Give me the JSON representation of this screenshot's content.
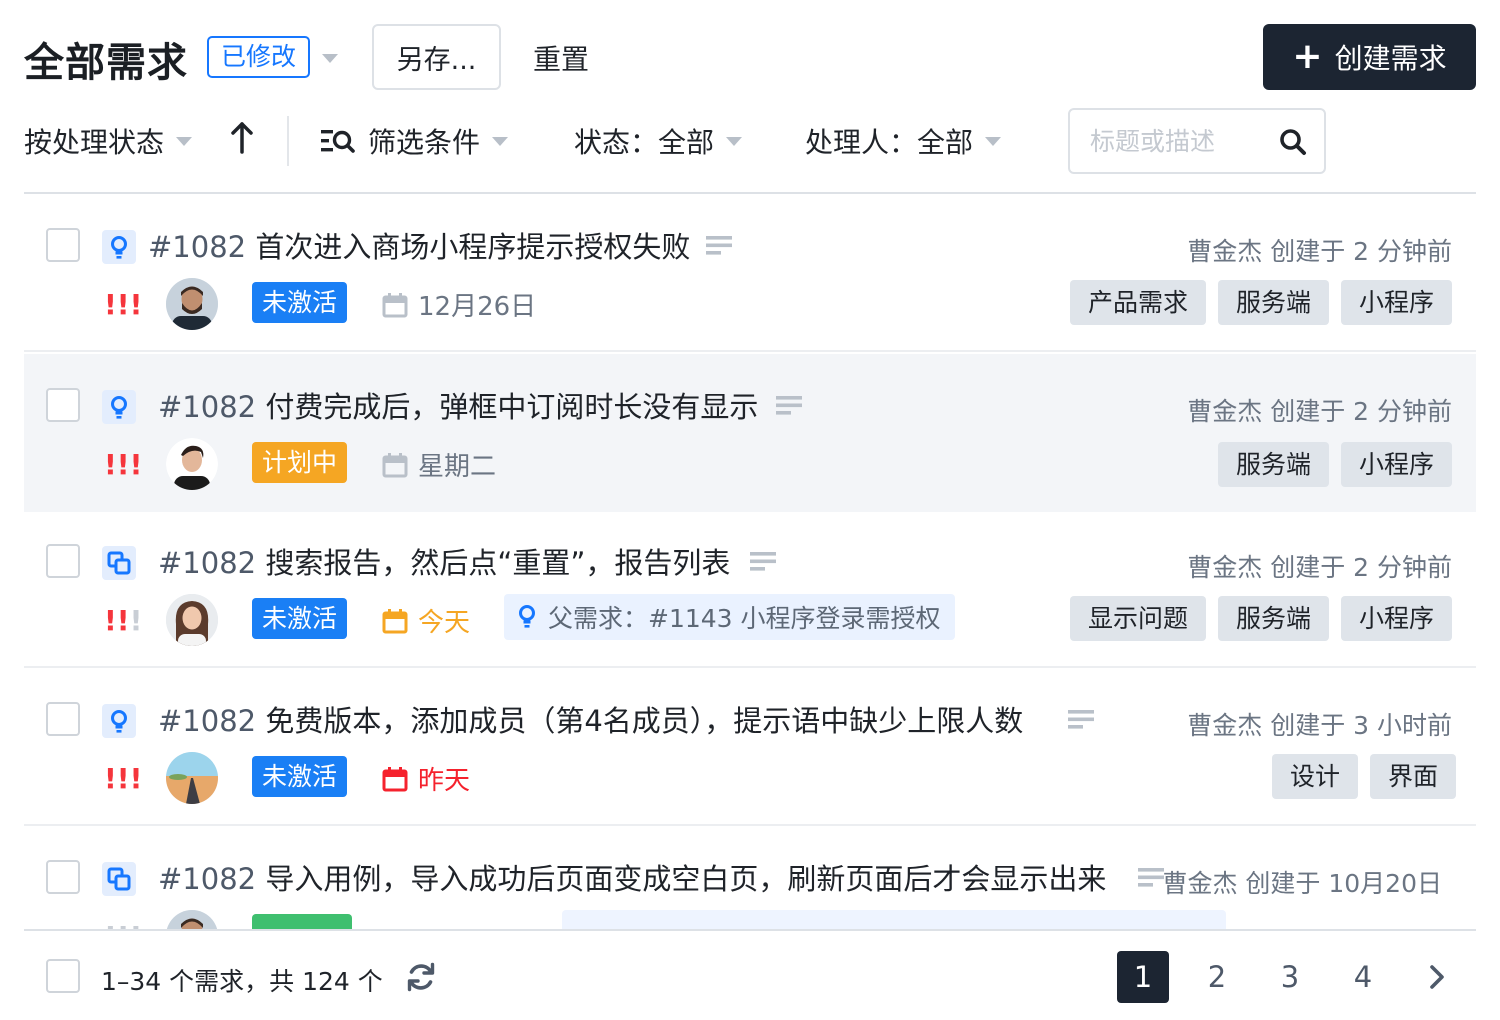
{
  "header": {
    "title": "全部需求",
    "modified_badge": "已修改",
    "save_as_label": "另存...",
    "reset_label": "重置",
    "create_label": "创建需求",
    "create_icon": "plus-icon"
  },
  "toolbar": {
    "sort_label": "按处理状态",
    "sort_direction_icon": "arrow-up-icon",
    "filter_label": "筛选条件",
    "status_filter": "状态：全部",
    "assignee_filter": "处理人：全部",
    "search_placeholder": "标题或描述",
    "search_value": ""
  },
  "rows": [
    {
      "type_icon": "idea-bulb-icon",
      "number": "#1082",
      "title": "首次进入商场小程序提示授权失败",
      "creator_meta": "曹金杰 创建于 2 分钟前",
      "priority": "!!!",
      "priority_level": 3,
      "status": "未激活",
      "status_color": "#1a7ff5",
      "date": "12月26日",
      "date_color": "#6b7583",
      "parent": "",
      "tags": [
        "产品需求",
        "服务端",
        "小程序"
      ]
    },
    {
      "type_icon": "idea-bulb-icon",
      "number": "#1082",
      "title": "付费完成后，弹框中订阅时长没有显示",
      "creator_meta": "曹金杰 创建于 2 分钟前",
      "priority": "!!!",
      "priority_level": 3,
      "status": "计划中",
      "status_color": "#f5a623",
      "date": "星期二",
      "date_color": "#6b7583",
      "parent": "",
      "tags": [
        "服务端",
        "小程序"
      ]
    },
    {
      "type_icon": "copy-squares-icon",
      "number": "#1082",
      "title": "搜索报告，然后点“重置”，报告列表",
      "creator_meta": "曹金杰 创建于 2 分钟前",
      "priority": "!!!",
      "priority_level": 2,
      "status": "未激活",
      "status_color": "#1a7ff5",
      "date": "今天",
      "date_color": "#f5a623",
      "parent": "父需求：#1143 小程序登录需授权",
      "tags": [
        "显示问题",
        "服务端",
        "小程序"
      ]
    },
    {
      "type_icon": "idea-bulb-icon",
      "number": "#1082",
      "title": "免费版本，添加成员（第4名成员），提示语中缺少上限人数",
      "creator_meta": "曹金杰 创建于 3 小时前",
      "priority": "!!!",
      "priority_level": 3,
      "status": "未激活",
      "status_color": "#1a7ff5",
      "date": "昨天",
      "date_color": "#f5222d",
      "parent": "",
      "tags": [
        "设计",
        "界面"
      ]
    },
    {
      "type_icon": "copy-squares-icon",
      "number": "#1082",
      "title": "导入用例，导入成功后页面变成空白页，刷新页面后才会显示出来",
      "creator_meta": "曹金杰 创建于 10月20日",
      "status_color": "#3fbf6f"
    }
  ],
  "footer": {
    "count_label": "1–34 个需求，共 124 个",
    "pages": [
      "1",
      "2",
      "3",
      "4"
    ],
    "current_page": "1"
  },
  "colors": {
    "accent": "#1677ff",
    "primary_dark": "#1c2532",
    "priority_high": "#f5353c"
  }
}
